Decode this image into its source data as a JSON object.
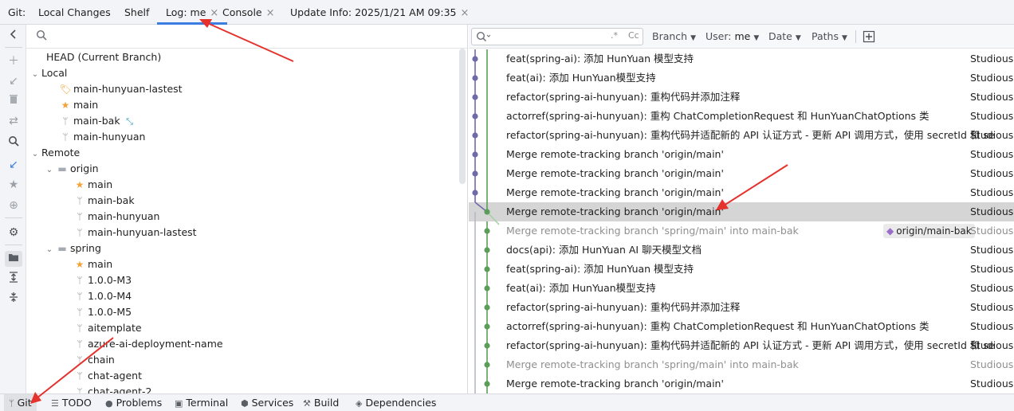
{
  "tabbar": {
    "prefix": "Git:",
    "tabs": [
      {
        "label": "Local Changes",
        "closable": false,
        "active": false
      },
      {
        "label": "Shelf",
        "closable": false,
        "active": false
      },
      {
        "label": "Log: me",
        "closable": true,
        "active": true
      },
      {
        "label": "Console",
        "closable": true,
        "active": false
      },
      {
        "label": "Update Info: 2025/1/21 AM 09:35",
        "closable": true,
        "active": false
      }
    ],
    "close_glyph": "×"
  },
  "branch_tree": {
    "head": "HEAD (Current Branch)",
    "local_label": "Local",
    "local": [
      {
        "label": "main-hunyuan-lastest",
        "icon": "tag-icon"
      },
      {
        "label": "main",
        "icon": "star-icon"
      },
      {
        "label": "main-bak",
        "icon": "branch-icon",
        "tracking": true
      },
      {
        "label": "main-hunyuan",
        "icon": "branch-icon"
      }
    ],
    "remote_label": "Remote",
    "remotes": [
      {
        "name": "origin",
        "branches": [
          {
            "label": "main",
            "icon": "star-icon"
          },
          {
            "label": "main-bak",
            "icon": "branch-icon"
          },
          {
            "label": "main-hunyuan",
            "icon": "branch-icon"
          },
          {
            "label": "main-hunyuan-lastest",
            "icon": "branch-icon"
          }
        ]
      },
      {
        "name": "spring",
        "branches": [
          {
            "label": "main",
            "icon": "star-icon"
          },
          {
            "label": "1.0.0-M3",
            "icon": "branch-icon"
          },
          {
            "label": "1.0.0-M4",
            "icon": "branch-icon"
          },
          {
            "label": "1.0.0-M5",
            "icon": "branch-icon"
          },
          {
            "label": "aitemplate",
            "icon": "branch-icon"
          },
          {
            "label": "azure-ai-deployment-name",
            "icon": "branch-icon"
          },
          {
            "label": "chain",
            "icon": "branch-icon"
          },
          {
            "label": "chat-agent",
            "icon": "branch-icon"
          },
          {
            "label": "chat-agent-2",
            "icon": "branch-icon"
          }
        ]
      }
    ]
  },
  "log_toolbar": {
    "search_options": ".*",
    "case_option": "Cc",
    "filters": {
      "branch": "Branch",
      "user_label": "User:",
      "user_value": "me",
      "date": "Date",
      "paths": "Paths"
    }
  },
  "commits": [
    {
      "message": "feat(spring-ai): 添加 HunYuan 模型支持",
      "author": "Studious",
      "dim": false
    },
    {
      "message": "feat(ai): 添加 HunYuan模型支持",
      "author": "Studious",
      "dim": false
    },
    {
      "message": "refactor(spring-ai-hunyuan): 重构代码并添加注释",
      "author": "Studious",
      "dim": false
    },
    {
      "message": "actorref(spring-ai-hunyuan): 重构 ChatCompletionRequest 和 HunYuanChatOptions 类",
      "author": "Studious",
      "dim": false
    },
    {
      "message": "refactor(spring-ai-hunyuan): 重构代码并适配新的 API 认证方式 - 更新 API 调用方式，使用 secretId 和 se",
      "author": "Studious",
      "dim": false
    },
    {
      "message": "Merge remote-tracking branch 'origin/main'",
      "author": "Studious",
      "dim": false
    },
    {
      "message": "Merge remote-tracking branch 'origin/main'",
      "author": "Studious",
      "dim": false
    },
    {
      "message": "Merge remote-tracking branch 'origin/main'",
      "author": "Studious",
      "dim": false
    },
    {
      "message": "Merge remote-tracking branch 'origin/main'",
      "author": "Studious",
      "dim": false,
      "selected": true
    },
    {
      "message": "Merge remote-tracking branch 'spring/main' into main-bak",
      "author": "Studious",
      "dim": true,
      "ref": "origin/main-bak"
    },
    {
      "message": "docs(api): 添加 HunYuan AI 聊天模型文档",
      "author": "Studious",
      "dim": false
    },
    {
      "message": "feat(spring-ai): 添加 HunYuan 模型支持",
      "author": "Studious",
      "dim": false
    },
    {
      "message": "feat(ai): 添加 HunYuan模型支持",
      "author": "Studious",
      "dim": false
    },
    {
      "message": "refactor(spring-ai-hunyuan): 重构代码并添加注释",
      "author": "Studious",
      "dim": false
    },
    {
      "message": "actorref(spring-ai-hunyuan): 重构 ChatCompletionRequest 和 HunYuanChatOptions 类",
      "author": "Studious",
      "dim": false
    },
    {
      "message": "refactor(spring-ai-hunyuan): 重构代码并适配新的 API 认证方式 - 更新 API 调用方式，使用 secretId 和 se",
      "author": "Studious",
      "dim": false
    },
    {
      "message": "Merge remote-tracking branch 'spring/main' into main-bak",
      "author": "Studious",
      "dim": true
    },
    {
      "message": "Merge remote-tracking branch 'origin/main'",
      "author": "Studious",
      "dim": false
    }
  ],
  "bottom_tabs": [
    {
      "label": "Git",
      "icon": "git-branch-icon",
      "active": true
    },
    {
      "label": "TODO",
      "icon": "list-icon",
      "active": false
    },
    {
      "label": "Problems",
      "icon": "problems-icon",
      "active": false
    },
    {
      "label": "Terminal",
      "icon": "terminal-icon",
      "active": false
    },
    {
      "label": "Services",
      "icon": "services-icon",
      "active": false
    },
    {
      "label": "Build",
      "icon": "hammer-icon",
      "active": false
    },
    {
      "label": "Dependencies",
      "icon": "layers-icon",
      "active": false
    }
  ],
  "colors": {
    "accent": "#3c7de1",
    "graph_purple": "#6f6aa8",
    "graph_green": "#5a9e5a",
    "annotation_red": "#e5322d",
    "selected_row": "#d5d5d5"
  }
}
